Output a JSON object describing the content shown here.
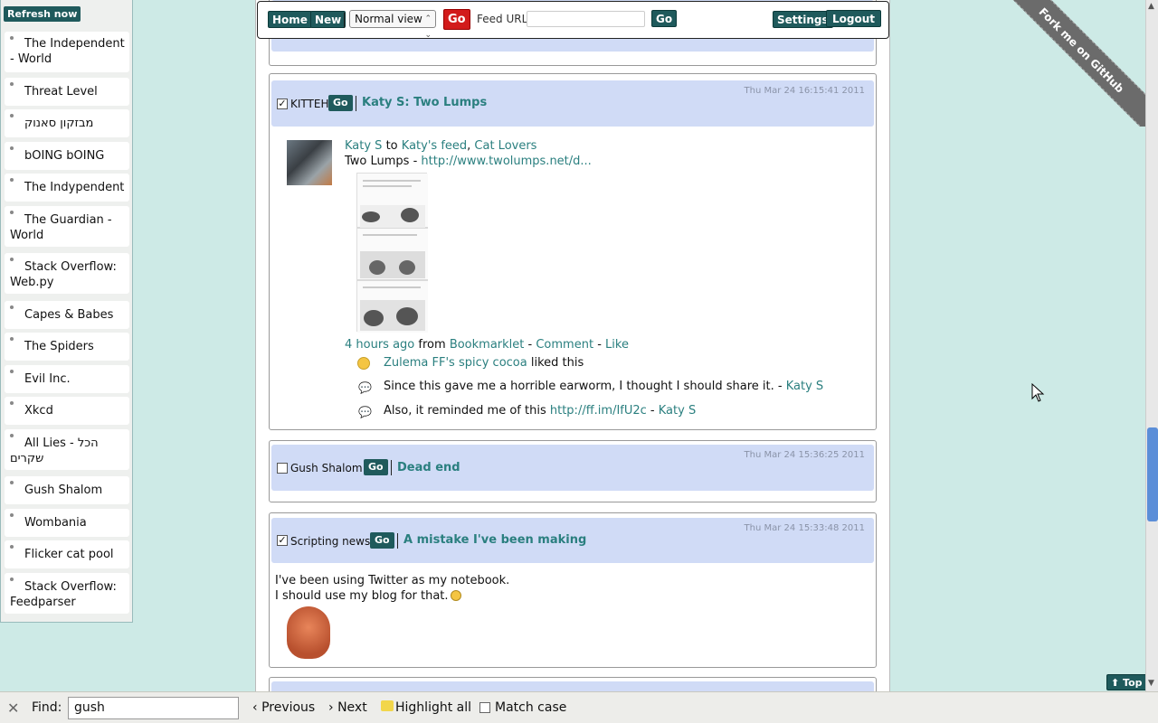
{
  "sidebar": {
    "refresh_label": "Refresh now",
    "feeds": [
      {
        "label": "The Independent - World"
      },
      {
        "label": "Threat Level"
      },
      {
        "label": "מבזקון סאנוק"
      },
      {
        "label": "bOING bOING"
      },
      {
        "label": "The Indypendent"
      },
      {
        "label": "The Guardian - World"
      },
      {
        "label": "Stack Overflow: Web.py"
      },
      {
        "label": "Capes & Babes"
      },
      {
        "label": "The Spiders"
      },
      {
        "label": "Evil Inc."
      },
      {
        "label": "Xkcd"
      },
      {
        "label": "All Lies - הכל שקרים"
      },
      {
        "label": "Gush Shalom"
      },
      {
        "label": "Wombania"
      },
      {
        "label": "Flicker cat pool"
      },
      {
        "label": "Stack Overflow: Feedparser"
      }
    ]
  },
  "topbar": {
    "home_label": "Home",
    "new_label": "New",
    "view_select": "Normal view",
    "go_red": "Go",
    "feed_url_label": "Feed URL",
    "feed_url_value": "",
    "go_label": "Go",
    "settings_label": "Settings",
    "logout_label": "Logout"
  },
  "ribbon": "Fork me on GitHub",
  "posts": {
    "kitteh": {
      "source": "KITTEH",
      "go": "Go",
      "title": "Katy S: Two Lumps",
      "timestamp": "Thu Mar 24 16:15:41 2011",
      "author": "Katy S",
      "to_text": "to",
      "feed1": "Katy's feed",
      "feed2": "Cat Lovers",
      "body_text": "Two Lumps -",
      "body_link": "http://www.twolumps.net/d...",
      "time_ago": "4 hours ago",
      "from_text": "from",
      "via": "Bookmarklet",
      "comment": "Comment",
      "like": "Like",
      "like_user": "Zulema FF's spicy cocoa",
      "liked_this": "liked this",
      "comment1_text": "Since this gave me a horrible earworm, I thought I should share it. -",
      "comment1_author": "Katy S",
      "comment2_text": "Also, it reminded me of this",
      "comment2_link": "http://ff.im/IfU2c",
      "comment2_author": "Katy S"
    },
    "gush": {
      "source": "Gush Shalom",
      "go": "Go",
      "title": "Dead end",
      "timestamp": "Thu Mar 24 15:36:25 2011"
    },
    "scripting": {
      "source": "Scripting news",
      "go": "Go",
      "title": "A mistake I've been making",
      "timestamp": "Thu Mar 24 15:33:48 2011",
      "line1": "I've been using Twitter as my notebook.",
      "line2": "I should use my blog for that."
    }
  },
  "top_button": "⬆ Top",
  "findbar": {
    "find_label": "Find:",
    "query": "gush",
    "previous": "Previous",
    "next": "Next",
    "highlight_all": "Highlight all",
    "match_case": "Match case"
  }
}
